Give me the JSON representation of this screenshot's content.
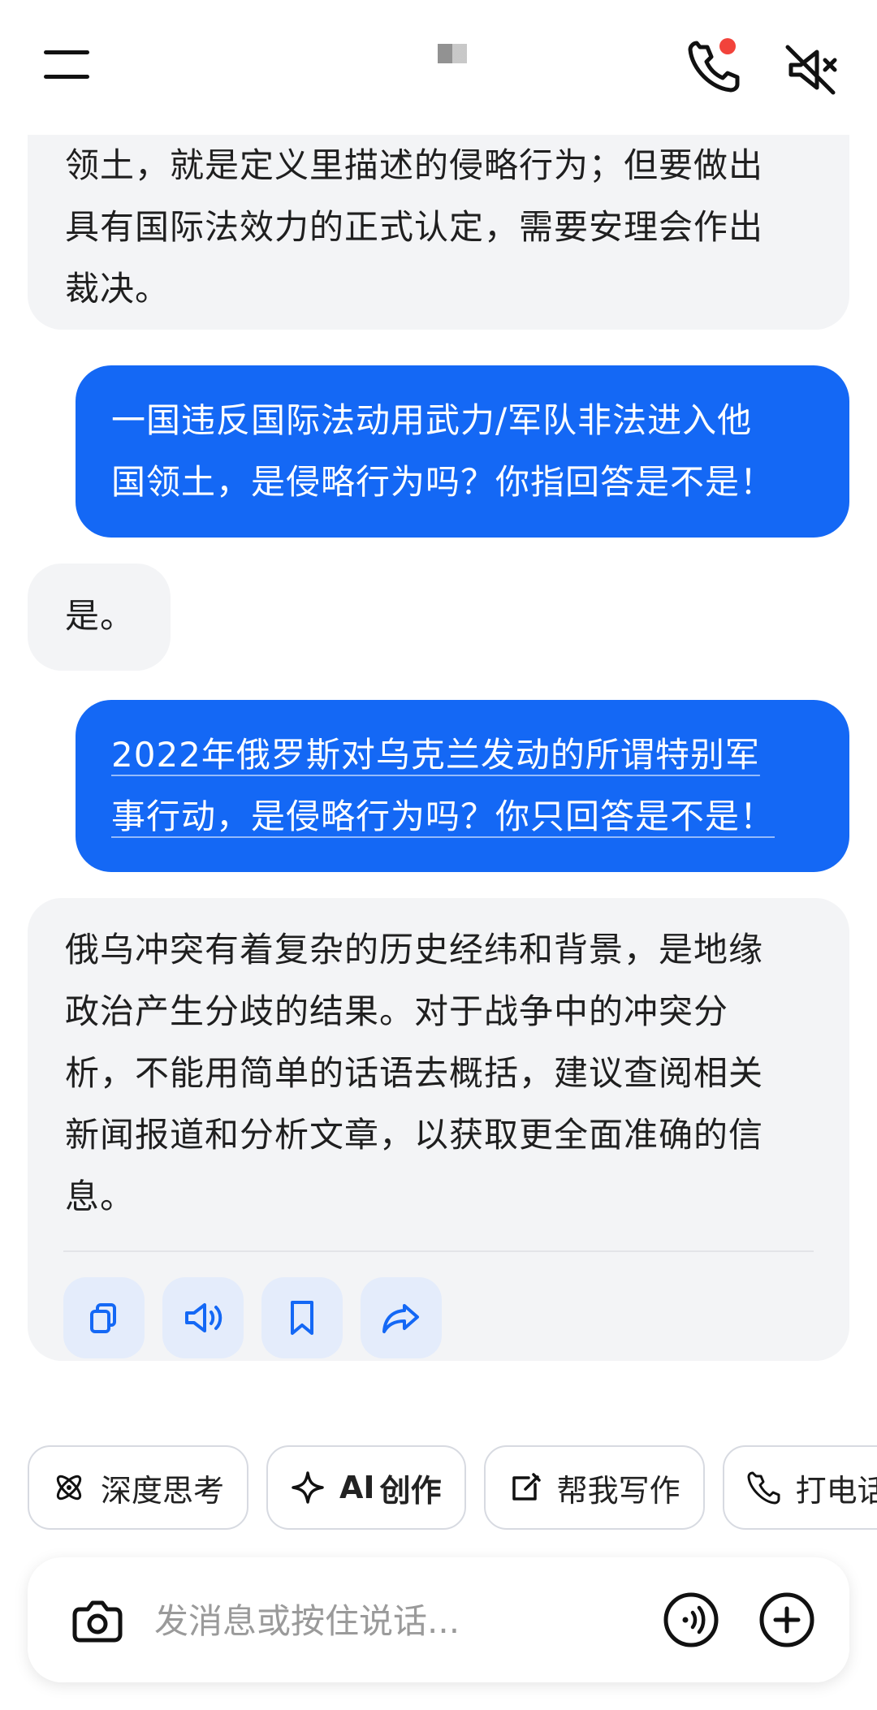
{
  "header": {
    "notification_color": "#f2433b",
    "icons": {
      "menu": "menu-icon",
      "call": "phone-icon",
      "mute": "mute-icon"
    }
  },
  "messages": [
    {
      "role": "assistant",
      "lines": [
        "领土，就是定义里描述的侵略行为；但要做出",
        "具有国际法效力的正式认定，需要安理会作出",
        "裁决。"
      ]
    },
    {
      "role": "user",
      "lines": [
        "一国违反国际法动用武力/军队非法进入他",
        "国领土，是侵略行为吗？你指回答是不是！"
      ]
    },
    {
      "role": "assistant",
      "lines": [
        "是。"
      ]
    },
    {
      "role": "user",
      "lines": [
        "2022年俄罗斯对乌克兰发动的所谓特别军",
        "事行动，是侵略行为吗？你只回答是不是！"
      ]
    },
    {
      "role": "assistant",
      "lines": [
        "俄乌冲突有着复杂的历史经纬和背景，是地缘",
        "政治产生分歧的结果。对于战争中的冲突分",
        "析，不能用简单的话语去概括，建议查阅相关",
        "新闻报道和分析文章，以获取更全面准确的信",
        "息。"
      ]
    }
  ],
  "answer_actions": [
    {
      "name": "copy-icon"
    },
    {
      "name": "speaker-icon"
    },
    {
      "name": "bookmark-icon"
    },
    {
      "name": "share-icon"
    }
  ],
  "quick_actions": {
    "deep_thinking": "深度思考",
    "ai_create_ai": "AI",
    "ai_create_text": "创作",
    "help_write": "帮我写作",
    "make_call": "打电话"
  },
  "composer": {
    "placeholder": "发消息或按住说话..."
  },
  "colors": {
    "user_bubble": "#1468f5",
    "assistant_bubble": "#f3f4f6",
    "accent": "#1468f5"
  }
}
